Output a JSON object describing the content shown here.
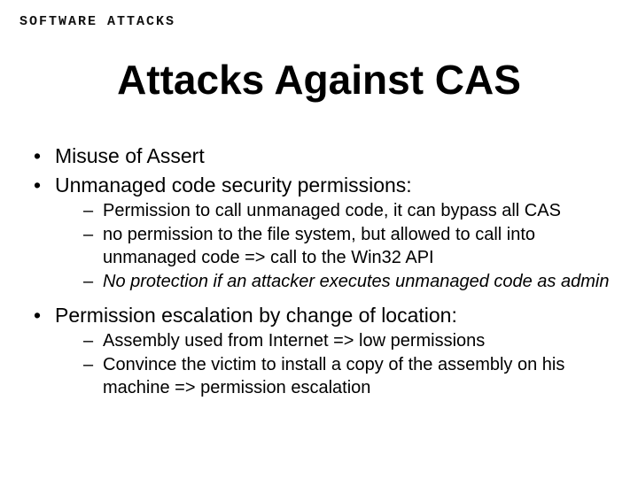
{
  "header": "Software Attacks",
  "title": "Attacks Against CAS",
  "bullets": [
    {
      "text": "Misuse of Assert",
      "sub": []
    },
    {
      "text": "Unmanaged code security permissions:",
      "sub": [
        {
          "text": "Permission to call unmanaged code, it can bypass all CAS",
          "italic": false
        },
        {
          "text": "no permission to the file system, but allowed to call into unmanaged code => call to the Win32 API",
          "italic": false
        },
        {
          "text": "No protection if an attacker executes unmanaged code as admin",
          "italic": true
        }
      ]
    },
    {
      "text": "Permission escalation by change of location:",
      "sub": [
        {
          "text": "Assembly used from Internet => low permissions",
          "italic": false
        },
        {
          "text": "Convince the victim to install a copy of the assembly on his machine => permission escalation",
          "italic": false
        }
      ]
    }
  ]
}
